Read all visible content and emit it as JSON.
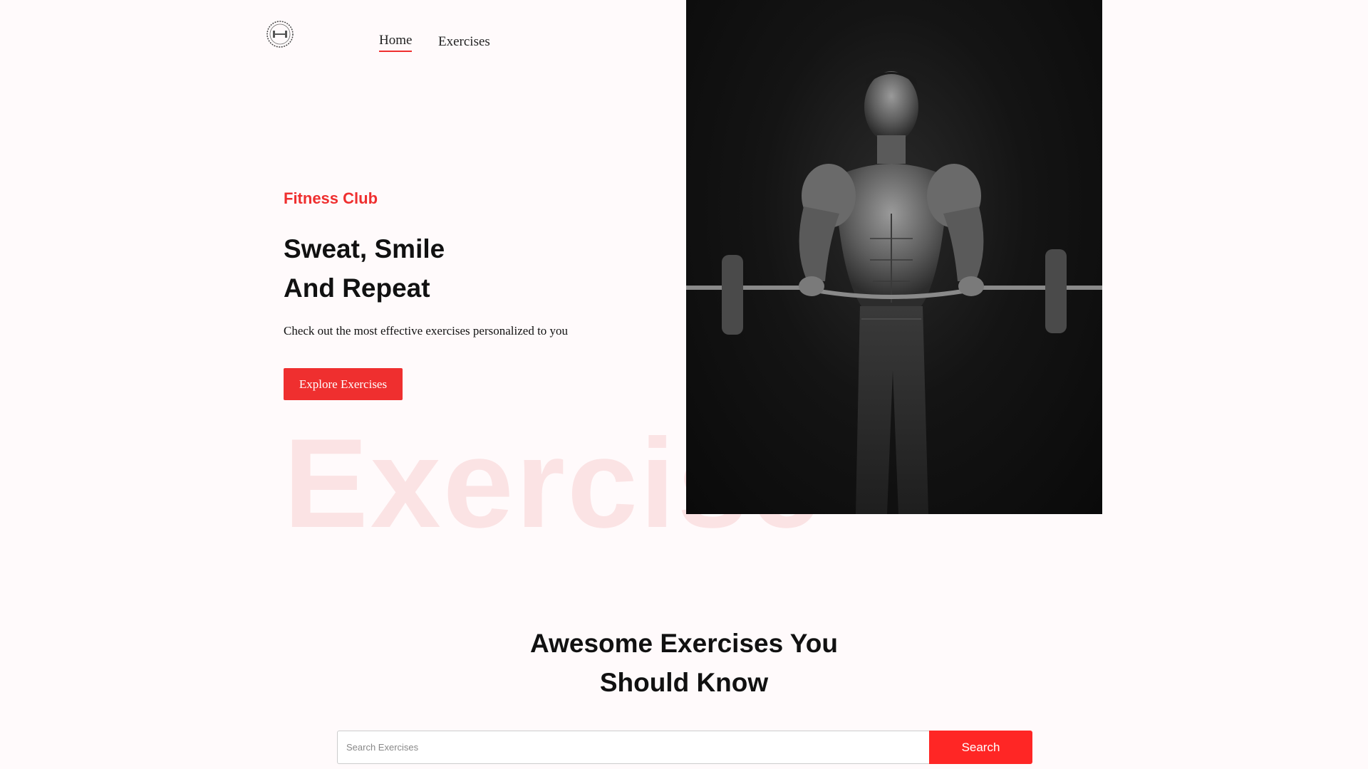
{
  "nav": {
    "links": [
      {
        "label": "Home"
      },
      {
        "label": "Exercises"
      }
    ]
  },
  "hero": {
    "tag": "Fitness Club",
    "title_line1": "Sweat, Smile",
    "title_line2": "And Repeat",
    "subtitle": "Check out the most effective exercises personalized to you",
    "cta_label": "Explore Exercises",
    "watermark": "Exercise"
  },
  "section": {
    "title_line1": "Awesome Exercises You",
    "title_line2": "Should Know"
  },
  "search": {
    "placeholder": "Search Exercises",
    "value": "",
    "button_label": "Search"
  },
  "colors": {
    "accent": "#ef2f2f",
    "background": "#fffafb",
    "watermark": "#fbe3e4"
  },
  "icons": {
    "logo": "dumbbell-logo-icon"
  }
}
